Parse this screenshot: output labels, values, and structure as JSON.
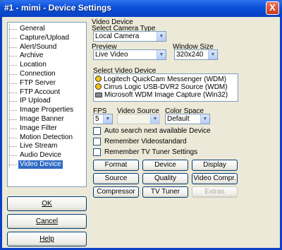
{
  "window": {
    "title": "#1 - mimi - Device Settings",
    "close_glyph": "X"
  },
  "tree": {
    "items": [
      "General",
      "Capture/Upload",
      "Alert/Sound",
      "Archive",
      "Location",
      "Connection",
      "FTP Server",
      "FTP Account",
      "IP Upload",
      "Image Properties",
      "Image Banner",
      "Image Filter",
      "Motion Detection",
      "Live Stream",
      "Audio Device",
      "Video Device"
    ],
    "selected": "Video Device"
  },
  "left_buttons": {
    "ok": "OK",
    "cancel": "Cancel",
    "help": "Help"
  },
  "panel": {
    "heading": "Video Device",
    "camera_type_label": "Select Camera Type",
    "camera_type_value": "Local Camera",
    "preview_label": "Preview",
    "preview_value": "Live Video",
    "window_size_label": "Window Size",
    "window_size_value": "320x240",
    "video_device_label": "Select Video Device",
    "devices": [
      "Logitech QuickCam Messenger (WDM)",
      "Cirrus Logic USB-DVR2 Source (WDM)",
      "Microsoft WDM Image Capture (Win32)"
    ],
    "fps_label": "FPS",
    "fps_value": "5",
    "video_source_label": "Video Source",
    "video_source_value": "",
    "color_space_label": "Color Space",
    "color_space_value": "Default",
    "checkboxes": [
      "Auto search next available Device",
      "Remember Videostandard",
      "Remember TV Tuner Settings"
    ],
    "buttons": {
      "format": "Format",
      "device": "Device",
      "display": "Display",
      "source": "Source",
      "quality": "Quality",
      "video_compr": "Video Compr.",
      "compressor": "Compressor",
      "tv_tuner": "TV Tuner",
      "extras": "Extras"
    }
  }
}
